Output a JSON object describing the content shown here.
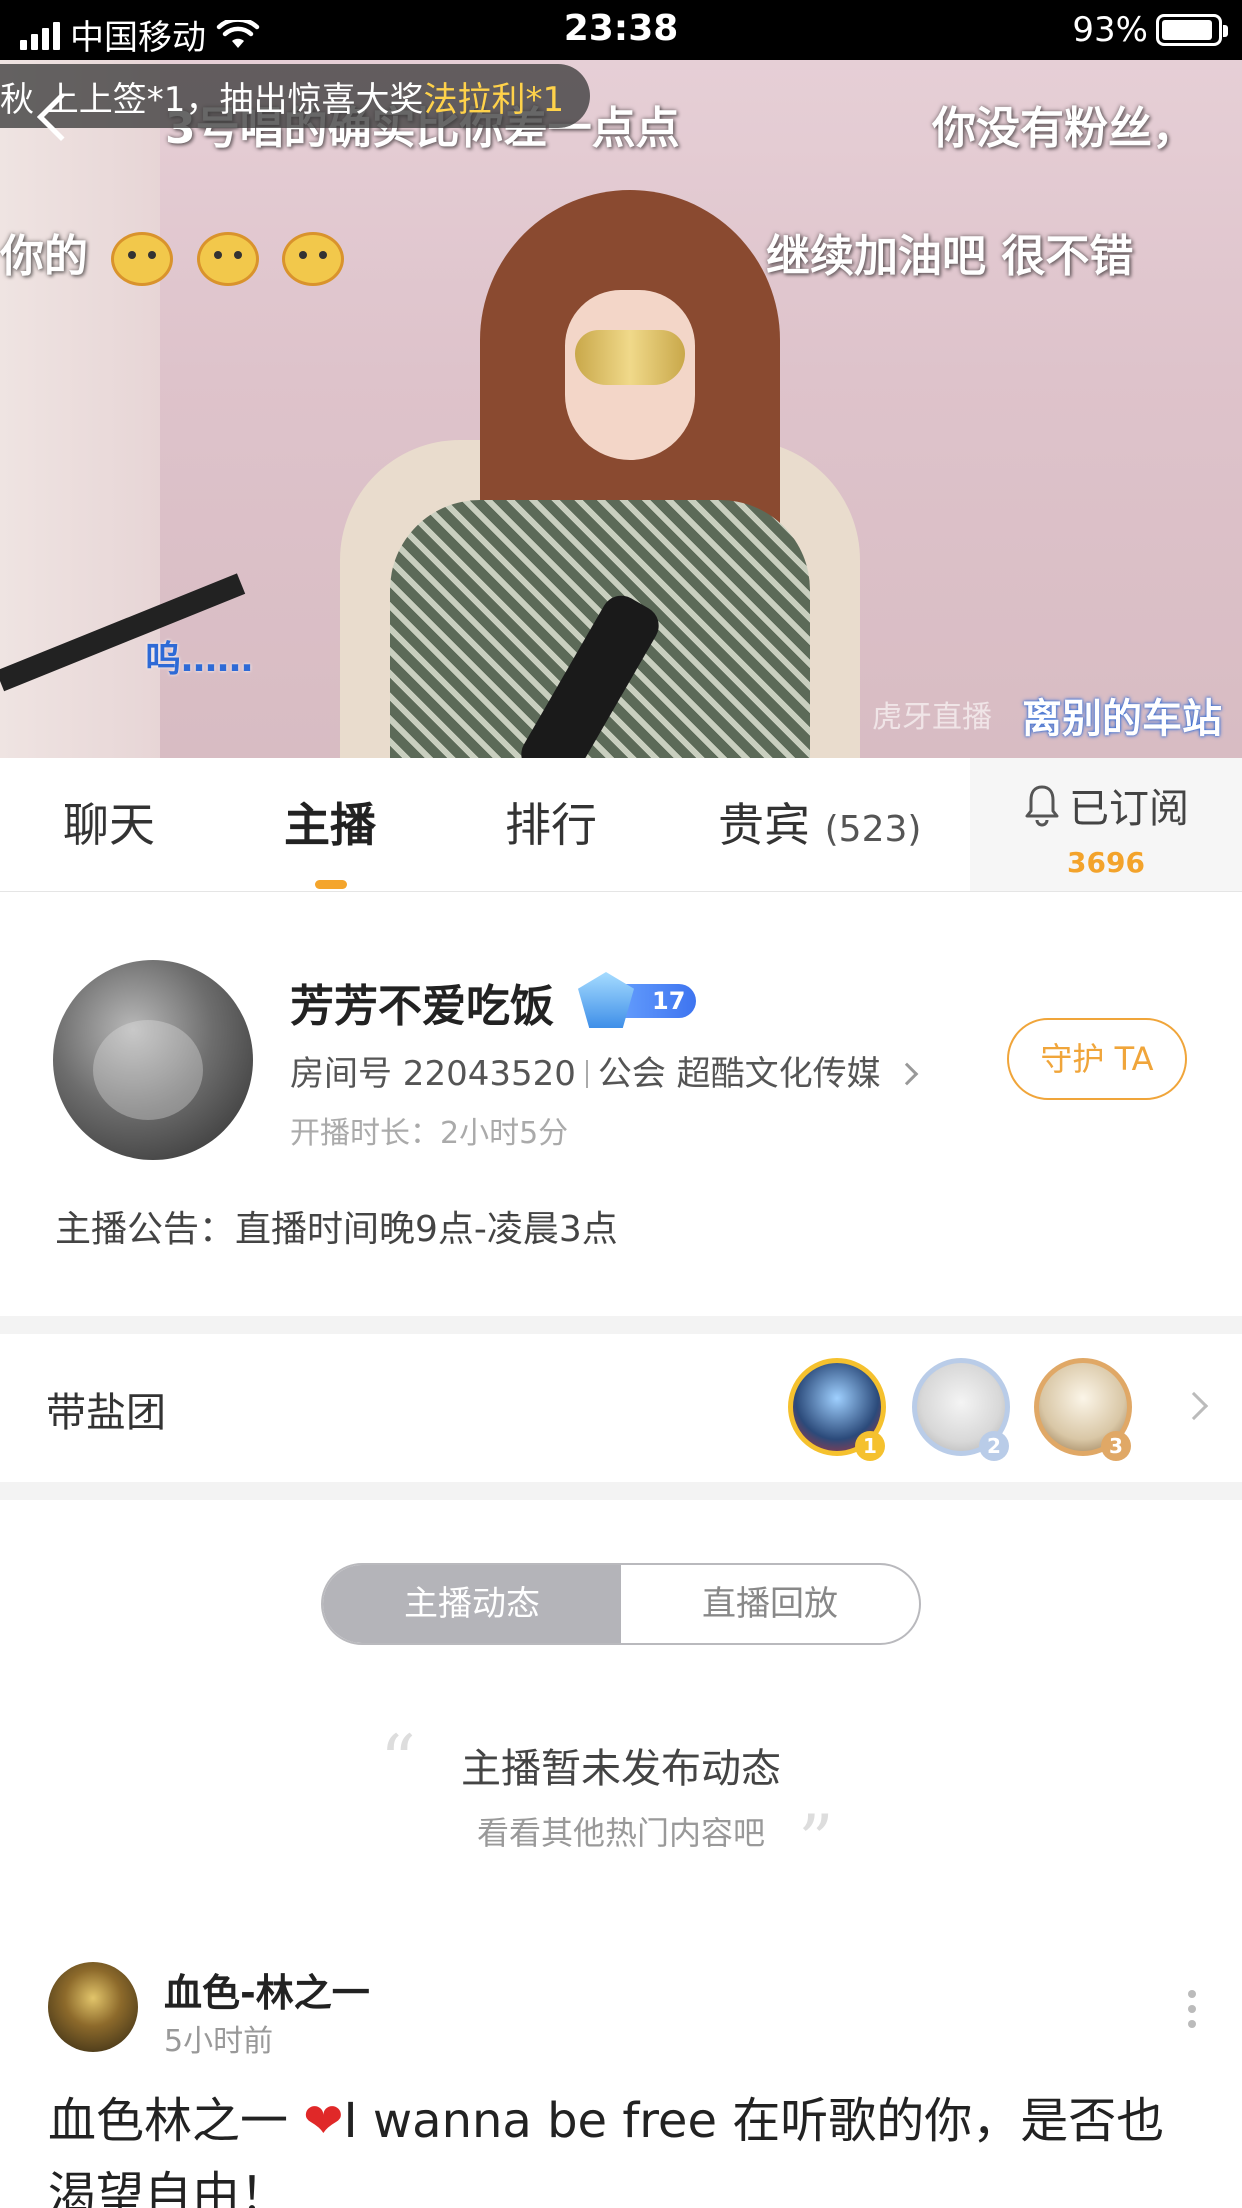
{
  "status_bar": {
    "carrier": "中国移动",
    "time": "23:38",
    "battery_percent": "93%",
    "battery_level": 0.93
  },
  "video": {
    "banner_prefix": "秋 上上签*1，抽出惊喜大奖 ",
    "banner_highlight": "法拉利*1",
    "danmaku": [
      "3号唱的确实比你差一点点",
      "你没有粉丝，",
      "你的",
      "继续加油吧 很不错",
      "呜……"
    ],
    "watermark": "离别的车站",
    "watermark_faint": "虎牙直播"
  },
  "tabs": {
    "items": [
      "聊天",
      "主播",
      "排行",
      "贵宾"
    ],
    "vip_count": "(523)",
    "active": "主播",
    "subscribe_label": "已订阅",
    "subscribe_count": "3696"
  },
  "streamer": {
    "name": "芳芳不爱吃饭",
    "level": "17",
    "room_label": "房间号 22043520",
    "guild_label": "公会 超酷文化传媒",
    "duration": "开播时长：2小时5分",
    "guard_button": "守护 TA",
    "notice": "主播公告：直播时间晚9点-凌晨3点"
  },
  "fan_group": {
    "title": "带盐团",
    "ranks": [
      "1",
      "2",
      "3"
    ],
    "colors": [
      "#f5c12e",
      "#b9cce8",
      "#e0a866"
    ]
  },
  "segmented": {
    "items": [
      "主播动态",
      "直播回放"
    ],
    "active": "主播动态"
  },
  "empty_state": {
    "title": "主播暂未发布动态",
    "subtitle": "看看其他热门内容吧"
  },
  "post": {
    "author": "血色-林之一",
    "time": "5小时前",
    "text_before_heart": "血色林之一 ",
    "heart": "❤",
    "text_after_heart": "I wanna be free 在听歌的你，是否也渴望自由！"
  },
  "colors": {
    "accent": "#f4a52c",
    "status_bar_bg": "#000000",
    "segment_active": "#b4b4b9"
  }
}
